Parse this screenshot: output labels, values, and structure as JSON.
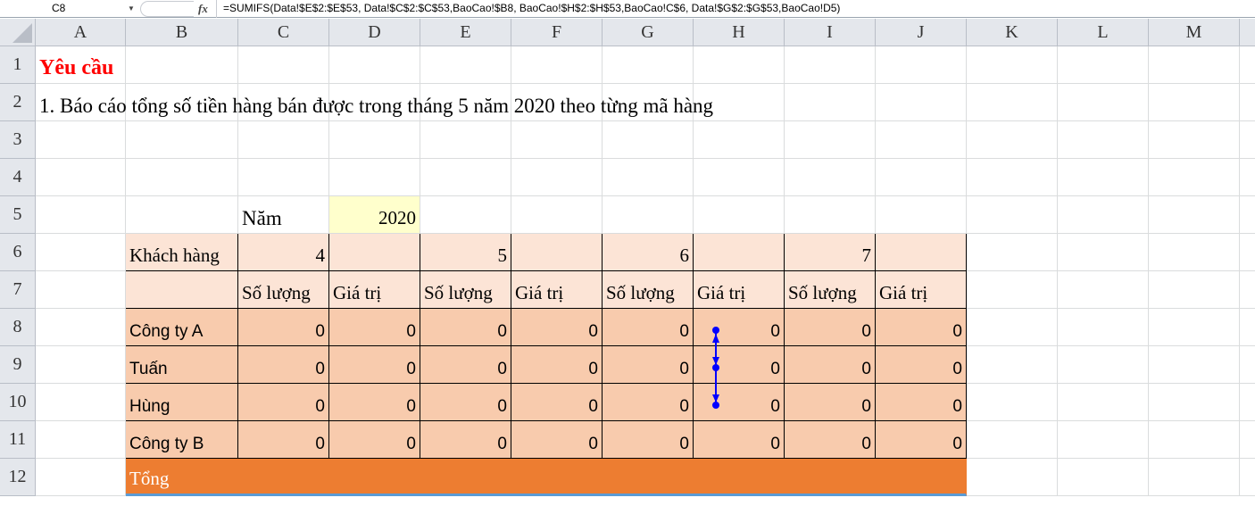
{
  "formula_bar": {
    "name_box": "C8",
    "fx_label": "fx",
    "formula": "=SUMIFS(Data!$E$2:$E$53, Data!$C$2:$C$53,BaoCao!$B8, BaoCao!$H$2:$H$53,BaoCao!C$6, Data!$G$2:$G$53,BaoCao!D5)"
  },
  "columns": [
    "A",
    "B",
    "C",
    "D",
    "E",
    "F",
    "G",
    "H",
    "I",
    "J",
    "K",
    "L",
    "M"
  ],
  "rows": [
    "1",
    "2",
    "3",
    "4",
    "5",
    "6",
    "7",
    "8",
    "9",
    "10",
    "11",
    "12"
  ],
  "cells": [
    {
      "ref": "A1",
      "value": "Yêu cầu",
      "style": "title"
    },
    {
      "ref": "A2",
      "value": "1. Báo cáo tổng số tiền hàng bán được trong tháng 5 năm 2020 theo từng mã hàng",
      "style": "text"
    },
    {
      "ref": "C5",
      "value": "Năm",
      "style": "text"
    },
    {
      "ref": "D5",
      "value": "2020",
      "style": "year"
    },
    {
      "ref": "B6",
      "value": "Khách hàng",
      "style": "hdr"
    },
    {
      "ref": "C6",
      "value": "4",
      "style": "hdrnum"
    },
    {
      "ref": "D6",
      "value": "",
      "style": "hdr"
    },
    {
      "ref": "E6",
      "value": "5",
      "style": "hdrnum"
    },
    {
      "ref": "F6",
      "value": "",
      "style": "hdr"
    },
    {
      "ref": "G6",
      "value": "6",
      "style": "hdrnum"
    },
    {
      "ref": "H6",
      "value": "",
      "style": "hdr"
    },
    {
      "ref": "I6",
      "value": "7",
      "style": "hdrnum"
    },
    {
      "ref": "J6",
      "value": "",
      "style": "hdr"
    },
    {
      "ref": "B7",
      "value": "",
      "style": "hdr"
    },
    {
      "ref": "C7",
      "value": "Số lượng",
      "style": "hdr"
    },
    {
      "ref": "D7",
      "value": "Giá trị",
      "style": "hdr"
    },
    {
      "ref": "E7",
      "value": "Số lượng",
      "style": "hdr"
    },
    {
      "ref": "F7",
      "value": "Giá trị",
      "style": "hdr"
    },
    {
      "ref": "G7",
      "value": "Số lượng",
      "style": "hdr"
    },
    {
      "ref": "H7",
      "value": "Giá trị",
      "style": "hdr"
    },
    {
      "ref": "I7",
      "value": "Số lượng",
      "style": "hdr"
    },
    {
      "ref": "J7",
      "value": "Giá trị",
      "style": "hdr"
    }
  ],
  "table_rows": [
    {
      "row": 8,
      "label": "Công ty A",
      "values": [
        "0",
        "0",
        "0",
        "0",
        "0",
        "0",
        "0",
        "0"
      ]
    },
    {
      "row": 9,
      "label": "Tuấn",
      "values": [
        "0",
        "0",
        "0",
        "0",
        "0",
        "0",
        "0",
        "0"
      ]
    },
    {
      "row": 10,
      "label": "Hùng",
      "values": [
        "0",
        "0",
        "0",
        "0",
        "0",
        "0",
        "0",
        "0"
      ]
    },
    {
      "row": 11,
      "label": "Công ty B",
      "values": [
        "0",
        "0",
        "0",
        "0",
        "0",
        "0",
        "0",
        "0"
      ]
    }
  ],
  "total": {
    "row": 12,
    "label": "Tổng"
  },
  "colors": {
    "header_fill": "#fce4d6",
    "data_fill": "#f8cbad",
    "total_fill": "#ed7d31",
    "title": "#ff0000",
    "trace_arrow": "#0000ff",
    "year_fill": "#ffffcc"
  }
}
